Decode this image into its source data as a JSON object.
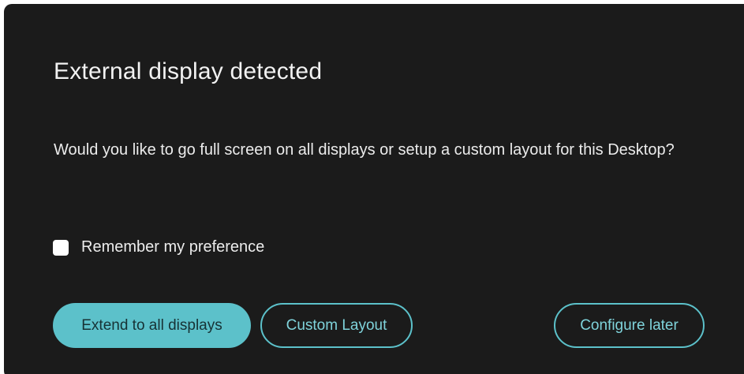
{
  "dialog": {
    "title": "External display detected",
    "message": "Would you like to go full screen on all displays or setup a custom layout for this Desktop?",
    "preference": {
      "label": "Remember my preference",
      "checked": false
    },
    "buttons": {
      "extend": "Extend to all displays",
      "custom": "Custom Layout",
      "later": "Configure later"
    }
  },
  "colors": {
    "dialog_background": "#1b1b1b",
    "accent": "#5cc1ca",
    "text": "#ececec"
  }
}
